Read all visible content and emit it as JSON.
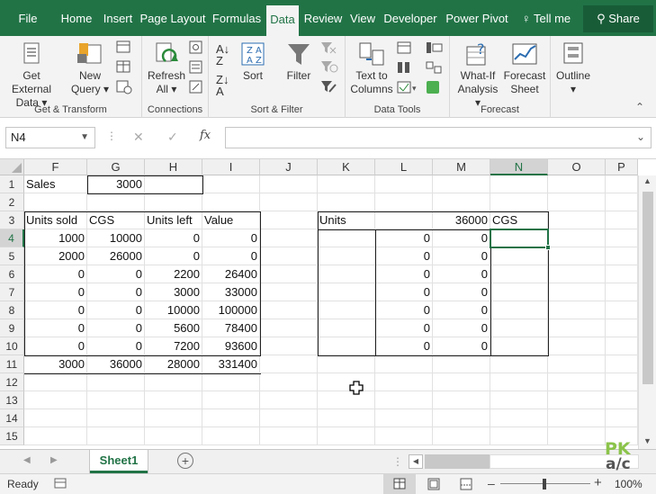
{
  "ribbon_tabs": [
    "File",
    "Home",
    "Insert",
    "Page Layout",
    "Formulas",
    "Data",
    "Review",
    "View",
    "Developer",
    "Power Pivot",
    "Tell me"
  ],
  "active_tab": "Data",
  "share_label": "Share",
  "groups": {
    "get_transform": {
      "label": "Get & Transform",
      "get_external_data": [
        "Get External",
        "Data"
      ],
      "new_query": [
        "New",
        "Query"
      ]
    },
    "connections": {
      "label": "Connections",
      "refresh_all": [
        "Refresh",
        "All"
      ]
    },
    "sort_filter": {
      "label": "Sort & Filter",
      "sort": "Sort",
      "filter": "Filter"
    },
    "data_tools": {
      "label": "Data Tools",
      "text_to_columns": [
        "Text to",
        "Columns"
      ]
    },
    "forecast": {
      "label": "Forecast",
      "what_if": [
        "What-If",
        "Analysis"
      ],
      "forecast_sheet": [
        "Forecast",
        "Sheet"
      ]
    },
    "outline": {
      "label": "Outline"
    }
  },
  "formula_bar": {
    "name_box": "N4",
    "fx": "fx",
    "cancel": "✕",
    "enter": "✓",
    "value": ""
  },
  "columns": [
    "F",
    "G",
    "H",
    "I",
    "J",
    "K",
    "L",
    "M",
    "N",
    "O",
    "P"
  ],
  "selected_column": "N",
  "rows": [
    "1",
    "2",
    "3",
    "4",
    "5",
    "6",
    "7",
    "8",
    "9",
    "10",
    "11",
    "12",
    "13",
    "14",
    "15"
  ],
  "selected_row": "4",
  "cells": {
    "F1": "Sales",
    "G1": "3000",
    "F3": "Units sold",
    "G3": "CGS",
    "H3": "Units left",
    "I3": "Value",
    "K3": "Units",
    "M3": "36000",
    "N3": "CGS",
    "F4": "1000",
    "G4": "10000",
    "H4": "0",
    "I4": "0",
    "L4": "0",
    "M4": "0",
    "F5": "2000",
    "G5": "26000",
    "H5": "0",
    "I5": "0",
    "L5": "0",
    "M5": "0",
    "F6": "0",
    "G6": "0",
    "H6": "2200",
    "I6": "26400",
    "L6": "0",
    "M6": "0",
    "F7": "0",
    "G7": "0",
    "H7": "3000",
    "I7": "33000",
    "L7": "0",
    "M7": "0",
    "F8": "0",
    "G8": "0",
    "H8": "10000",
    "I8": "100000",
    "L8": "0",
    "M8": "0",
    "F9": "0",
    "G9": "0",
    "H9": "5600",
    "I9": "78400",
    "L9": "0",
    "M9": "0",
    "F10": "0",
    "G10": "0",
    "H10": "7200",
    "I10": "93600",
    "L10": "0",
    "M10": "0",
    "F11": "3000",
    "G11": "36000",
    "H11": "28000",
    "I11": "331400"
  },
  "sheet_tab": "Sheet1",
  "status": {
    "ready": "Ready",
    "zoom": "100%"
  },
  "watermark": [
    "PK",
    "a/c"
  ],
  "colors": {
    "accent": "#217346",
    "accent_dark": "#185c37"
  }
}
